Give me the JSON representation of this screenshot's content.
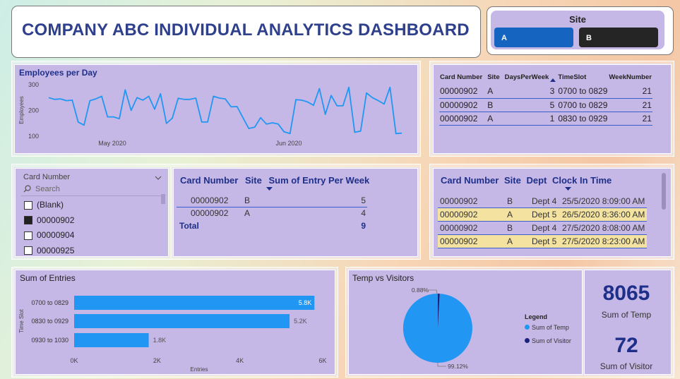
{
  "header": {
    "title": "COMPANY ABC INDIVIDUAL ANALYTICS DASHBOARD"
  },
  "site_slicer": {
    "title": "Site",
    "options": [
      "A",
      "B"
    ],
    "colors": {
      "A": "#1565c0",
      "B": "#252525"
    }
  },
  "employees_chart": {
    "title": "Employees per Day",
    "ylabel": "Employees",
    "yticks": [
      "300",
      "200",
      "100"
    ],
    "xticks": [
      "May 2020",
      "Jun 2020"
    ]
  },
  "chart_data": [
    {
      "type": "line",
      "title": "Employees per Day",
      "ylabel": "Employees",
      "xlabel": "",
      "x_ticks": [
        "May 2020",
        "Jun 2020"
      ],
      "ylim": [
        100,
        300
      ],
      "values": [
        250,
        243,
        245,
        238,
        240,
        155,
        143,
        238,
        245,
        255,
        175,
        175,
        168,
        280,
        200,
        250,
        240,
        255,
        205,
        265,
        150,
        170,
        247,
        243,
        243,
        248,
        155,
        155,
        255,
        248,
        245,
        214,
        215,
        172,
        130,
        135,
        172,
        147,
        152,
        147,
        117,
        110,
        242,
        240,
        233,
        220,
        285,
        185,
        258,
        218,
        218,
        290,
        115,
        120,
        268,
        250,
        238,
        225,
        290,
        110,
        112
      ],
      "color": "#2196f3"
    },
    {
      "type": "bar",
      "title": "Sum of Entries",
      "categories": [
        "0700 to 0829",
        "0830 to 0929",
        "0930 to 1030"
      ],
      "values": [
        5800,
        5200,
        1800
      ],
      "data_labels": [
        "5.8K",
        "5.2K",
        "1.8K"
      ],
      "xlabel": "Entries",
      "ylabel": "Time Slot",
      "x_ticks": [
        "0K",
        "2K",
        "4K",
        "6K"
      ],
      "xlim": [
        0,
        6000
      ],
      "color": "#2196f3"
    },
    {
      "type": "pie",
      "title": "Temp vs Visitors",
      "labels": [
        "Sum of Temp",
        "Sum of Visitor"
      ],
      "values": [
        8065,
        72
      ],
      "percent_labels": [
        "99.12%",
        "0.88%"
      ],
      "colors": [
        "#2196f3",
        "#1a237e"
      ]
    }
  ],
  "days_table": {
    "headers": [
      "Card Number",
      "Site",
      "DaysPerWeek",
      "TimeSlot",
      "WeekNumber"
    ],
    "rows": [
      [
        "00000902",
        "A",
        "3",
        "0700 to 0829",
        "21"
      ],
      [
        "00000902",
        "B",
        "5",
        "0700 to 0829",
        "21"
      ],
      [
        "00000902",
        "A",
        "1",
        "0830 to 0929",
        "21"
      ]
    ]
  },
  "card_slicer": {
    "title": "Card Number",
    "search_placeholder": "Search",
    "items": [
      {
        "label": "(Blank)",
        "checked": false
      },
      {
        "label": "00000902",
        "checked": true
      },
      {
        "label": "00000904",
        "checked": false
      },
      {
        "label": "00000925",
        "checked": false
      }
    ]
  },
  "entry_table": {
    "headers": [
      "Card Number",
      "Site",
      "Sum of Entry Per Week"
    ],
    "rows": [
      [
        "00000902",
        "B",
        "5"
      ],
      [
        "00000902",
        "A",
        "4"
      ]
    ],
    "total_label": "Total",
    "total_value": "9"
  },
  "clock_table": {
    "headers": [
      "Card Number",
      "Site",
      "Dept",
      "Clock In Time"
    ],
    "rows": [
      [
        "00000902",
        "B",
        "Dept 4",
        "25/5/2020 8:09:00 AM"
      ],
      [
        "00000902",
        "A",
        "Dept 5",
        "26/5/2020 8:36:00 AM"
      ],
      [
        "00000902",
        "B",
        "Dept 4",
        "27/5/2020 8:08:00 AM"
      ],
      [
        "00000902",
        "A",
        "Dept 5",
        "27/5/2020 8:23:00 AM"
      ]
    ],
    "highlight_color": "#f3e2a0"
  },
  "entries_chart": {
    "title": "Sum of Entries"
  },
  "pie_chart": {
    "title": "Temp vs Visitors",
    "legend_title": "Legend",
    "legend_items": [
      "Sum of Temp",
      "Sum of Visitor"
    ]
  },
  "kpis": [
    {
      "value": "8065",
      "label": "Sum of Temp"
    },
    {
      "value": "72",
      "label": "Sum of Visitor"
    }
  ]
}
